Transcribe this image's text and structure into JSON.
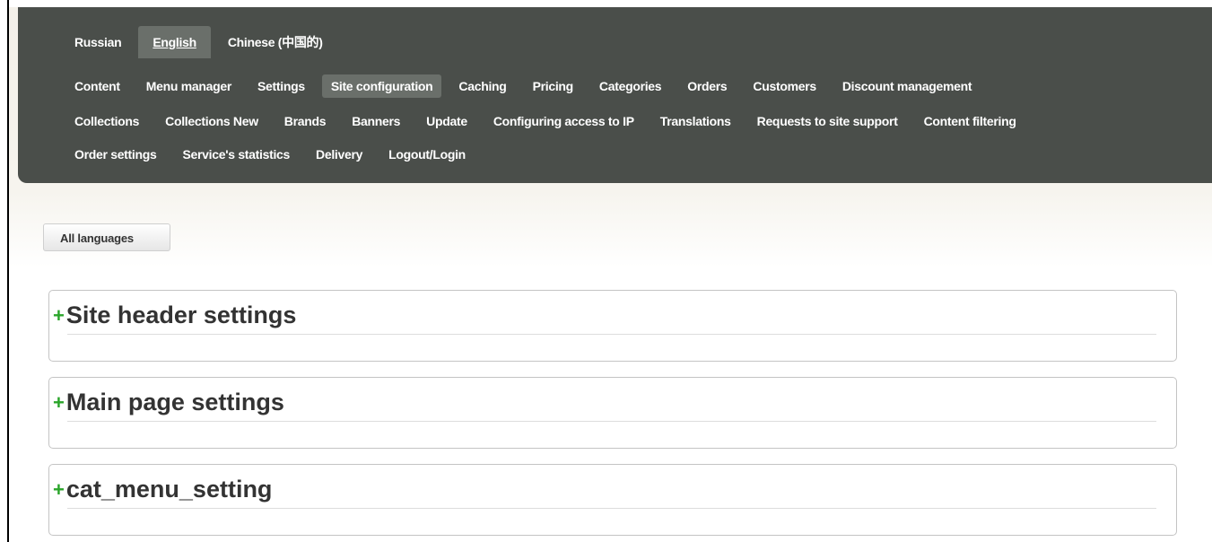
{
  "languages": [
    {
      "label": "Russian",
      "active": false
    },
    {
      "label": "English",
      "active": true
    },
    {
      "label": "Chinese (中国的)",
      "active": false
    }
  ],
  "nav": {
    "row1": [
      "Content",
      "Menu manager",
      "Settings",
      "Site configuration",
      "Caching",
      "Pricing",
      "Categories",
      "Orders",
      "Customers",
      "Discount management"
    ],
    "row2": [
      "Collections",
      "Collections New",
      "Brands",
      "Banners",
      "Update",
      "Configuring access to IP",
      "Translations",
      "Requests to site support",
      "Content filtering"
    ],
    "row3": [
      "Order settings",
      "Service's statistics",
      "Delivery",
      "Logout/Login"
    ],
    "active": "Site configuration"
  },
  "language_filter": {
    "label": "All languages"
  },
  "panels": [
    {
      "expand_symbol": "+",
      "title": "Site header settings",
      "highlighted": true
    },
    {
      "expand_symbol": "+",
      "title": "Main page settings",
      "highlighted": false
    },
    {
      "expand_symbol": "+",
      "title": "cat_menu_setting",
      "highlighted": false
    }
  ],
  "colors": {
    "header_bg": "#4a4e4a",
    "active_tab_bg": "#6a6f6a",
    "plus_green": "#2aa52a",
    "highlight_yellow": "#f5f546"
  }
}
